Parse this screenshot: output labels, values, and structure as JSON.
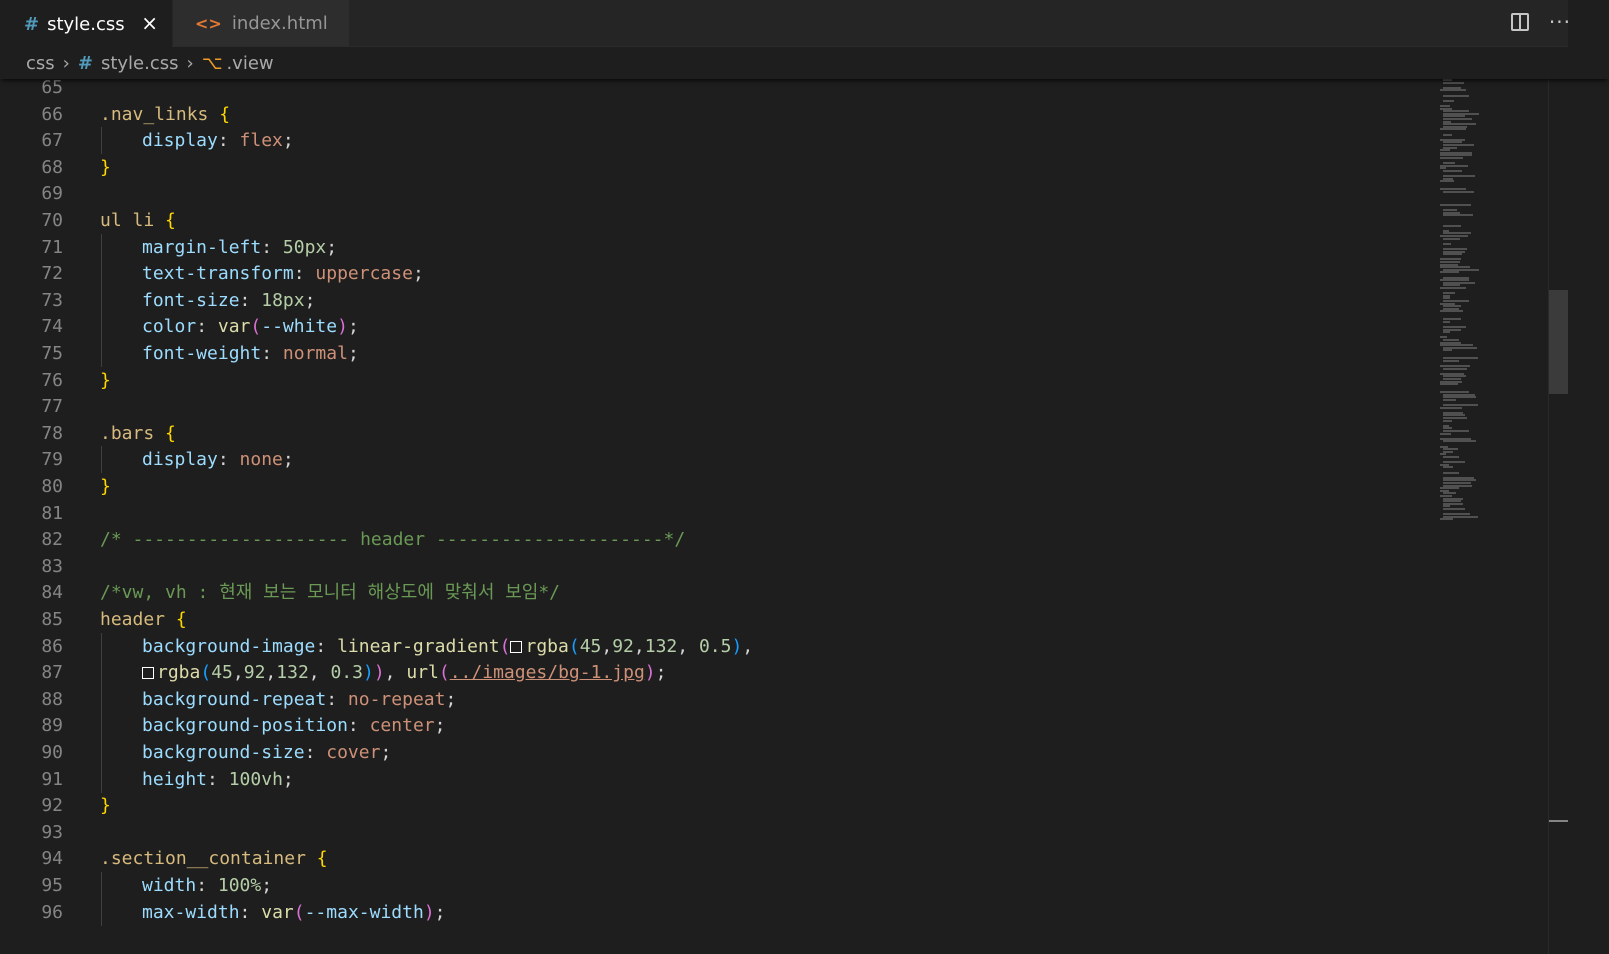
{
  "tabs": [
    {
      "label": "style.css",
      "icon": "css-hash-icon",
      "active": true,
      "close": "×"
    },
    {
      "label": "index.html",
      "icon": "html-tag-icon",
      "active": false
    }
  ],
  "tab_actions": {
    "split": "split-editor-icon",
    "more": "···"
  },
  "breadcrumb": {
    "folder": "css",
    "file": "style.css",
    "symbol": ".view",
    "separator": "›"
  },
  "editor": {
    "lines": [
      {
        "n": 65,
        "tokens": []
      },
      {
        "n": 66,
        "tokens": [
          {
            "t": ".nav_links",
            "c": "sel"
          },
          {
            "t": " ",
            "c": "pun"
          },
          {
            "t": "{",
            "c": "brace"
          }
        ]
      },
      {
        "n": 67,
        "indent": true,
        "tokens": [
          {
            "t": "display",
            "c": "prop"
          },
          {
            "t": ": ",
            "c": "pun"
          },
          {
            "t": "flex",
            "c": "val"
          },
          {
            "t": ";",
            "c": "pun"
          }
        ]
      },
      {
        "n": 68,
        "tokens": [
          {
            "t": "}",
            "c": "brace"
          }
        ]
      },
      {
        "n": 69,
        "tokens": []
      },
      {
        "n": 70,
        "tokens": [
          {
            "t": "ul li",
            "c": "sel"
          },
          {
            "t": " ",
            "c": "pun"
          },
          {
            "t": "{",
            "c": "brace"
          }
        ]
      },
      {
        "n": 71,
        "indent": true,
        "tokens": [
          {
            "t": "margin-left",
            "c": "prop"
          },
          {
            "t": ": ",
            "c": "pun"
          },
          {
            "t": "50px",
            "c": "num"
          },
          {
            "t": ";",
            "c": "pun"
          }
        ]
      },
      {
        "n": 72,
        "indent": true,
        "tokens": [
          {
            "t": "text-transform",
            "c": "prop"
          },
          {
            "t": ": ",
            "c": "pun"
          },
          {
            "t": "uppercase",
            "c": "val"
          },
          {
            "t": ";",
            "c": "pun"
          }
        ]
      },
      {
        "n": 73,
        "indent": true,
        "tokens": [
          {
            "t": "font-size",
            "c": "prop"
          },
          {
            "t": ": ",
            "c": "pun"
          },
          {
            "t": "18px",
            "c": "num"
          },
          {
            "t": ";",
            "c": "pun"
          }
        ]
      },
      {
        "n": 74,
        "indent": true,
        "tokens": [
          {
            "t": "color",
            "c": "prop"
          },
          {
            "t": ": ",
            "c": "pun"
          },
          {
            "t": "var",
            "c": "fn"
          },
          {
            "t": "(",
            "c": "paren"
          },
          {
            "t": "--white",
            "c": "prop"
          },
          {
            "t": ")",
            "c": "paren"
          },
          {
            "t": ";",
            "c": "pun"
          }
        ]
      },
      {
        "n": 75,
        "indent": true,
        "tokens": [
          {
            "t": "font-weight",
            "c": "prop"
          },
          {
            "t": ": ",
            "c": "pun"
          },
          {
            "t": "normal",
            "c": "val"
          },
          {
            "t": ";",
            "c": "pun"
          }
        ]
      },
      {
        "n": 76,
        "tokens": [
          {
            "t": "}",
            "c": "brace"
          }
        ]
      },
      {
        "n": 77,
        "tokens": []
      },
      {
        "n": 78,
        "tokens": [
          {
            "t": ".bars",
            "c": "sel"
          },
          {
            "t": " ",
            "c": "pun"
          },
          {
            "t": "{",
            "c": "brace"
          }
        ]
      },
      {
        "n": 79,
        "indent": true,
        "tokens": [
          {
            "t": "display",
            "c": "prop"
          },
          {
            "t": ": ",
            "c": "pun"
          },
          {
            "t": "none",
            "c": "val"
          },
          {
            "t": ";",
            "c": "pun"
          }
        ]
      },
      {
        "n": 80,
        "tokens": [
          {
            "t": "}",
            "c": "brace"
          }
        ]
      },
      {
        "n": 81,
        "tokens": []
      },
      {
        "n": 82,
        "tokens": [
          {
            "t": "/* -------------------- header ---------------------*/",
            "c": "cmt"
          }
        ]
      },
      {
        "n": 83,
        "tokens": []
      },
      {
        "n": 84,
        "tokens": [
          {
            "t": "/*vw, vh : 현재 보는 모니터 해상도에 맞춰서 보임*/",
            "c": "cmt"
          }
        ]
      },
      {
        "n": 85,
        "tokens": [
          {
            "t": "header",
            "c": "sel"
          },
          {
            "t": " ",
            "c": "pun"
          },
          {
            "t": "{",
            "c": "brace"
          }
        ]
      },
      {
        "n": 86,
        "indent": true,
        "tokens": [
          {
            "t": "background-image",
            "c": "prop"
          },
          {
            "t": ": ",
            "c": "pun"
          },
          {
            "t": "linear-gradient",
            "c": "fn"
          },
          {
            "t": "(",
            "c": "paren"
          },
          {
            "t": "",
            "c": "swatch"
          },
          {
            "t": "rgba",
            "c": "fn"
          },
          {
            "t": "(",
            "c": "paren2"
          },
          {
            "t": "45",
            "c": "num"
          },
          {
            "t": ",",
            "c": "pun"
          },
          {
            "t": "92",
            "c": "num"
          },
          {
            "t": ",",
            "c": "pun"
          },
          {
            "t": "132",
            "c": "num"
          },
          {
            "t": ", ",
            "c": "pun"
          },
          {
            "t": "0.5",
            "c": "num"
          },
          {
            "t": ")",
            "c": "paren2"
          },
          {
            "t": ",",
            "c": "pun"
          }
        ]
      },
      {
        "n": 87,
        "indent": true,
        "tokens": [
          {
            "t": "",
            "c": "swatch"
          },
          {
            "t": "rgba",
            "c": "fn"
          },
          {
            "t": "(",
            "c": "paren2"
          },
          {
            "t": "45",
            "c": "num"
          },
          {
            "t": ",",
            "c": "pun"
          },
          {
            "t": "92",
            "c": "num"
          },
          {
            "t": ",",
            "c": "pun"
          },
          {
            "t": "132",
            "c": "num"
          },
          {
            "t": ", ",
            "c": "pun"
          },
          {
            "t": "0.3",
            "c": "num"
          },
          {
            "t": ")",
            "c": "paren2"
          },
          {
            "t": ")",
            "c": "paren"
          },
          {
            "t": ", ",
            "c": "pun"
          },
          {
            "t": "url",
            "c": "fn"
          },
          {
            "t": "(",
            "c": "paren"
          },
          {
            "t": "../images/bg-1.jpg",
            "c": "url"
          },
          {
            "t": ")",
            "c": "paren"
          },
          {
            "t": ";",
            "c": "pun"
          }
        ]
      },
      {
        "n": 88,
        "indent": true,
        "tokens": [
          {
            "t": "background-repeat",
            "c": "prop"
          },
          {
            "t": ": ",
            "c": "pun"
          },
          {
            "t": "no-repeat",
            "c": "val"
          },
          {
            "t": ";",
            "c": "pun"
          }
        ]
      },
      {
        "n": 89,
        "indent": true,
        "tokens": [
          {
            "t": "background-position",
            "c": "prop"
          },
          {
            "t": ": ",
            "c": "pun"
          },
          {
            "t": "center",
            "c": "val"
          },
          {
            "t": ";",
            "c": "pun"
          }
        ]
      },
      {
        "n": 90,
        "indent": true,
        "tokens": [
          {
            "t": "background-size",
            "c": "prop"
          },
          {
            "t": ": ",
            "c": "pun"
          },
          {
            "t": "cover",
            "c": "val"
          },
          {
            "t": ";",
            "c": "pun"
          }
        ]
      },
      {
        "n": 91,
        "indent": true,
        "tokens": [
          {
            "t": "height",
            "c": "prop"
          },
          {
            "t": ": ",
            "c": "pun"
          },
          {
            "t": "100vh",
            "c": "num"
          },
          {
            "t": ";",
            "c": "pun"
          }
        ]
      },
      {
        "n": 92,
        "tokens": [
          {
            "t": "}",
            "c": "brace"
          }
        ]
      },
      {
        "n": 93,
        "tokens": []
      },
      {
        "n": 94,
        "tokens": [
          {
            "t": ".section__container",
            "c": "sel"
          },
          {
            "t": " ",
            "c": "pun"
          },
          {
            "t": "{",
            "c": "brace"
          }
        ]
      },
      {
        "n": 95,
        "indent": true,
        "tokens": [
          {
            "t": "width",
            "c": "prop"
          },
          {
            "t": ": ",
            "c": "pun"
          },
          {
            "t": "100%",
            "c": "num"
          },
          {
            "t": ";",
            "c": "pun"
          }
        ]
      },
      {
        "n": 96,
        "indent": true,
        "tokens": [
          {
            "t": "max-width",
            "c": "prop"
          },
          {
            "t": ": ",
            "c": "pun"
          },
          {
            "t": "var",
            "c": "fn"
          },
          {
            "t": "(",
            "c": "paren"
          },
          {
            "t": "--max-width",
            "c": "prop"
          },
          {
            "t": ")",
            "c": "paren"
          },
          {
            "t": ";",
            "c": "pun"
          }
        ]
      }
    ]
  },
  "colors": {
    "editor_bg": "#1e1e1e",
    "tab_bar_bg": "#252526",
    "selector": "#d7ba7d",
    "property": "#9cdcfe",
    "value": "#ce9178",
    "number": "#b5cea8",
    "comment": "#6a9955",
    "brace": "#ffd700"
  }
}
